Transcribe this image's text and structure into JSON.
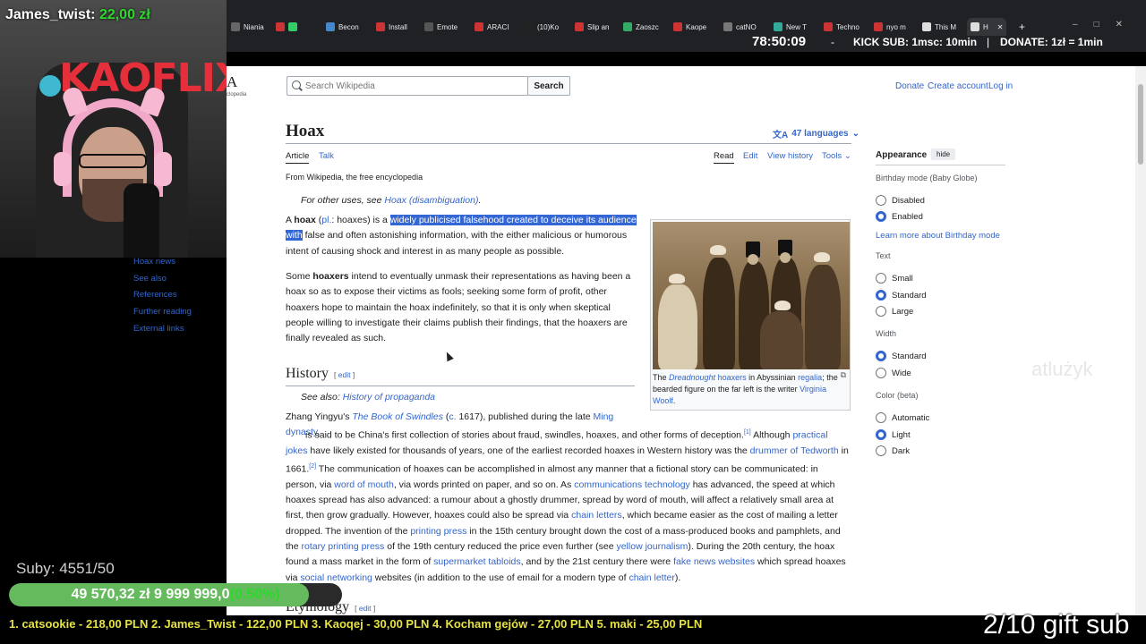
{
  "browser": {
    "tabs": [
      {
        "label": "Nianiа"
      },
      {
        "label": ""
      },
      {
        "label": "Becon"
      },
      {
        "label": "Install"
      },
      {
        "label": "Emote"
      },
      {
        "label": "ARACI"
      },
      {
        "label": "(10)Ko"
      },
      {
        "label": "Slip an"
      },
      {
        "label": "Zaoszc"
      },
      {
        "label": "Kaope"
      },
      {
        "label": "catNO"
      },
      {
        "label": "New T"
      },
      {
        "label": "Techno"
      },
      {
        "label": "nyo m"
      },
      {
        "label": "This M"
      },
      {
        "label": "H"
      }
    ],
    "new_tab": "+"
  },
  "wiki": {
    "logo_glyph": "A",
    "logo_tag": "clopedia",
    "search_placeholder": "Search Wikipedia",
    "search_button": "Search",
    "donate": "Donate",
    "create_account": "Create account",
    "log_in": "Log in",
    "title": "Hoax",
    "languages": "47 languages",
    "tabs": {
      "article": "Article",
      "talk": "Talk",
      "read": "Read",
      "edit": "Edit",
      "history": "View history",
      "tools": "Tools"
    },
    "from": "From Wikipedia, the free encyclopedia",
    "hatnote_prefix": "For other uses, see ",
    "hatnote_link": "Hoax (disambiguation)",
    "hatnote_suffix": ".",
    "toc": [
      "Hoax news",
      "See also",
      "References",
      "Further reading",
      "External links"
    ],
    "history_heading": "History",
    "edit_label": "edit",
    "see_also_prefix": "See also: ",
    "see_also_link": "History of propaganda",
    "etymology_heading": "Etymology",
    "caption_the": "The ",
    "caption_dreadnought": "Dreadnought",
    "caption_hoaxers": "hoaxers",
    "caption_mid": " in Abyssinian ",
    "caption_regalia": "regalia",
    "caption_rest": "; the bearded figure on the far left is the writer ",
    "caption_woolf": "Virginia Woolf",
    "caption_end": "."
  },
  "appearance": {
    "title": "Appearance",
    "hide": "hide",
    "birthday_label": "Birthday mode (Baby Globe)",
    "disabled": "Disabled",
    "enabled": "Enabled",
    "learn_more": "Learn more about Birthday mode",
    "text_label": "Text",
    "small": "Small",
    "standard": "Standard",
    "large": "Large",
    "width_label": "Width",
    "width_standard": "Standard",
    "wide": "Wide",
    "color_label": "Color (beta)",
    "automatic": "Automatic",
    "light": "Light",
    "dark": "Dark"
  },
  "stream": {
    "brand": "KAOFLIX",
    "donor": "James_twist: ",
    "donor_amount": "22,00 zł",
    "timer": "78:50:09",
    "dash": "-",
    "kick_sub": "KICK SUB: 1msc: 10min",
    "pipe": "|",
    "donate_rate": "DONATE: 1zł = 1min",
    "subs": "Suby: 4551/50",
    "goal_text": "49 570,32 zł  9 999 999,0",
    "goal_pct": "(0.50%)",
    "goal_fraction": 0.005,
    "ticker": "1. catsookie - 218,00 PLN   2. James_Twist - 122,00 PLN   3. Kaoqej - 30,00 PLN   4. Kocham gejów - 27,00 PLN   5. maki - 25,00 PLN",
    "gift_sub": "2/10 gift sub",
    "ghost": "atlużyk"
  },
  "colors": {
    "link": "#3366cc",
    "brand_red": "#e5303b",
    "goal_green": "#6fd466",
    "highlight": "#3367d6"
  }
}
